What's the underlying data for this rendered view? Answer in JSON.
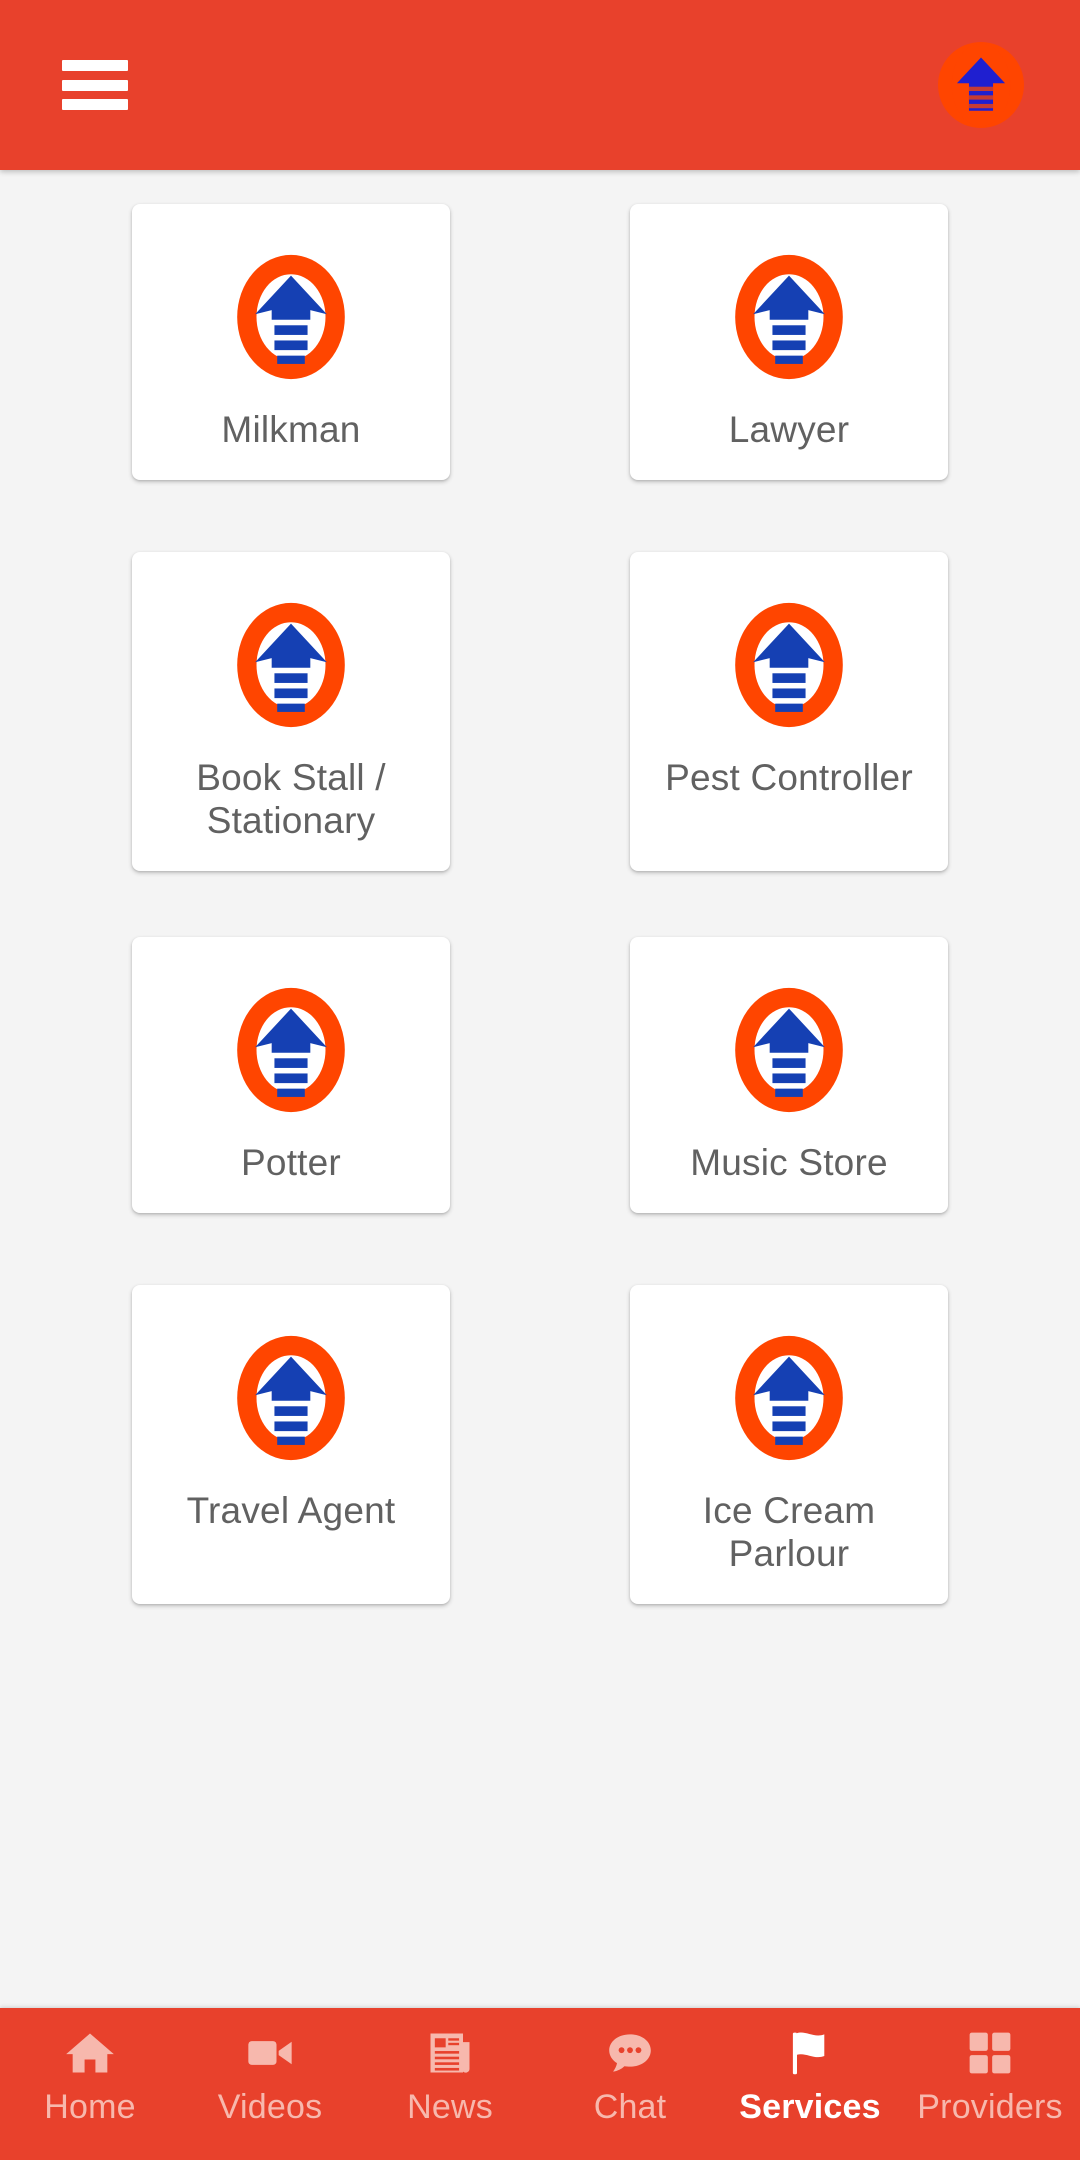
{
  "theme": {
    "appbar_color": "#e8412c",
    "accent_orange": "#ff4500",
    "accent_blue": "#1540b3",
    "page_background": "#f4f4f4",
    "card_background": "#ffffff",
    "label_color": "#616161",
    "nav_inactive_color": "#f7b8ad",
    "nav_active_color": "#ffffff"
  },
  "appbar": {
    "menu_icon": "hamburger-menu-icon",
    "logo_icon": "app-logo-arrow-icon",
    "title": ""
  },
  "services": [
    {
      "label": "Milkman",
      "icon": "service-arrow-icon"
    },
    {
      "label": "Lawyer",
      "icon": "service-arrow-icon"
    },
    {
      "label": "Book Stall / Stationary",
      "icon": "service-arrow-icon"
    },
    {
      "label": "Pest Controller",
      "icon": "service-arrow-icon"
    },
    {
      "label": "Potter",
      "icon": "service-arrow-icon"
    },
    {
      "label": "Music Store",
      "icon": "service-arrow-icon"
    },
    {
      "label": "Travel Agent",
      "icon": "service-arrow-icon"
    },
    {
      "label": "Ice Cream Parlour",
      "icon": "service-arrow-icon"
    }
  ],
  "bottom_nav": {
    "active": "Services",
    "items": [
      {
        "label": "Home",
        "icon": "home-icon",
        "active": false
      },
      {
        "label": "Videos",
        "icon": "video-camera-icon",
        "active": false
      },
      {
        "label": "News",
        "icon": "newspaper-icon",
        "active": false
      },
      {
        "label": "Chat",
        "icon": "chat-bubble-icon",
        "active": false
      },
      {
        "label": "Services",
        "icon": "flag-icon",
        "active": true
      },
      {
        "label": "Providers",
        "icon": "grid-squares-icon",
        "active": false
      }
    ]
  }
}
